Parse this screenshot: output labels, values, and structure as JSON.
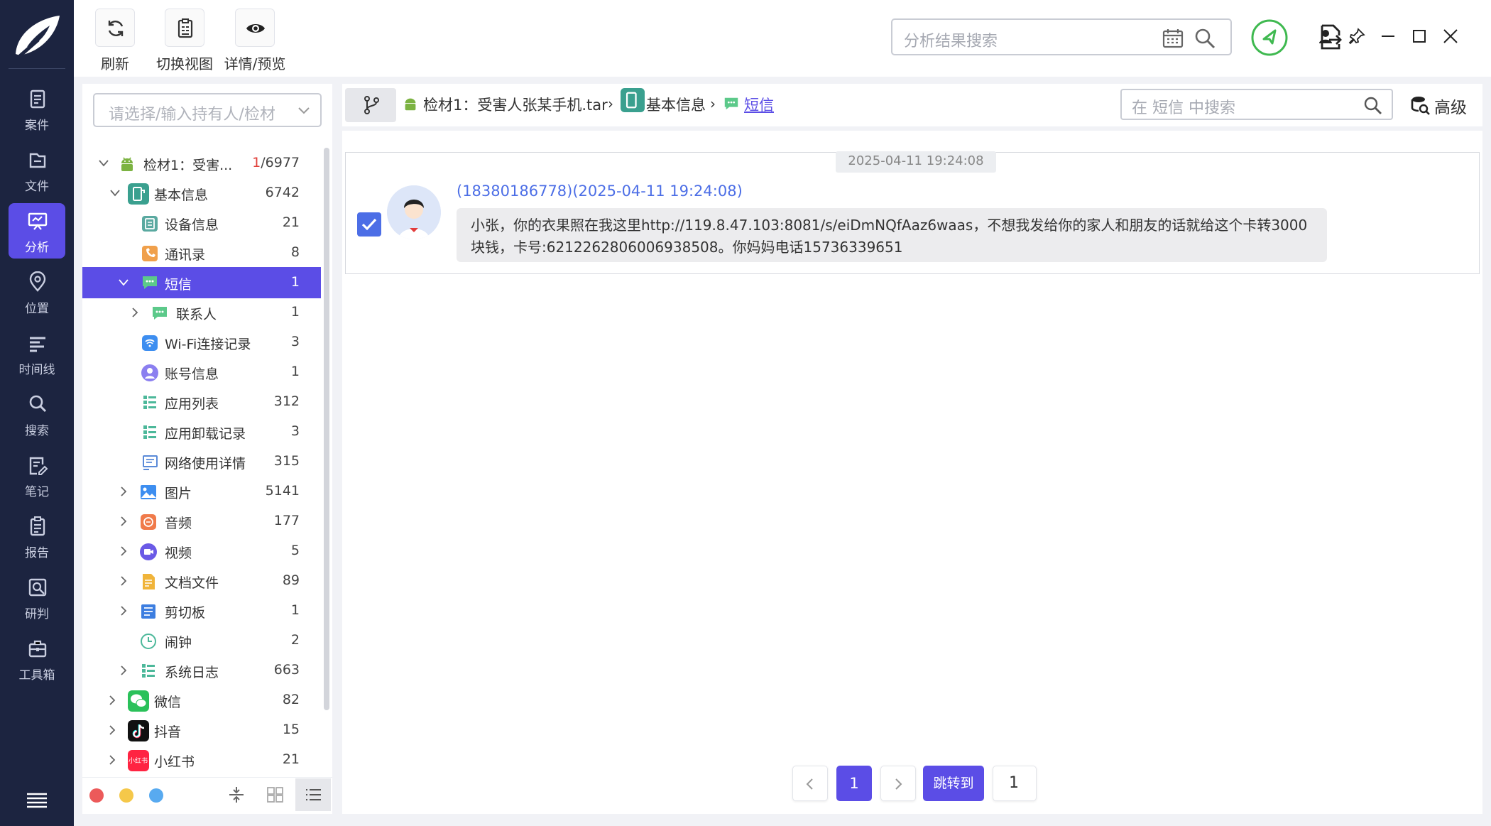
{
  "nav": {
    "items": [
      {
        "label": "案件",
        "icon": "clipboard-icon"
      },
      {
        "label": "文件",
        "icon": "folder-icon"
      },
      {
        "label": "分析",
        "icon": "analysis-icon"
      },
      {
        "label": "位置",
        "icon": "location-pin-icon"
      },
      {
        "label": "时间线",
        "icon": "timeline-icon"
      },
      {
        "label": "搜索",
        "icon": "search-icon"
      },
      {
        "label": "笔记",
        "icon": "note-icon"
      },
      {
        "label": "报告",
        "icon": "report-icon"
      },
      {
        "label": "研判",
        "icon": "judge-icon"
      },
      {
        "label": "工具箱",
        "icon": "toolbox-icon"
      }
    ],
    "active": "分析"
  },
  "toolbar": {
    "refresh_label": "刷新",
    "switch_view_label": "切换视图",
    "detail_preview_label": "详情/预览",
    "search_placeholder": "分析结果搜索"
  },
  "tree": {
    "select_placeholder": "请选择/输入持有人/检材",
    "rows": [
      {
        "name": "检材1：受害...",
        "count_hl": "1",
        "count_rest": "/6977",
        "icon": "android-icon"
      },
      {
        "name": "基本信息",
        "count": "6742",
        "icon": "basic-info-icon"
      },
      {
        "name": "设备信息",
        "count": "21",
        "icon": "device-info-icon"
      },
      {
        "name": "通讯录",
        "count": "8",
        "icon": "contacts-icon"
      },
      {
        "name": "短信",
        "count": "1",
        "icon": "sms-icon"
      },
      {
        "name": "联系人",
        "count": "1",
        "icon": "sms-contact-icon"
      },
      {
        "name": "Wi-Fi连接记录",
        "count": "3",
        "icon": "wifi-icon"
      },
      {
        "name": "账号信息",
        "count": "1",
        "icon": "account-icon"
      },
      {
        "name": "应用列表",
        "count": "312",
        "icon": "app-list-icon"
      },
      {
        "name": "应用卸载记录",
        "count": "3",
        "icon": "uninstall-icon"
      },
      {
        "name": "网络使用详情",
        "count": "315",
        "icon": "network-icon"
      },
      {
        "name": "图片",
        "count": "5141",
        "icon": "image-icon"
      },
      {
        "name": "音频",
        "count": "177",
        "icon": "audio-icon"
      },
      {
        "name": "视频",
        "count": "5",
        "icon": "video-icon"
      },
      {
        "name": "文档文件",
        "count": "89",
        "icon": "document-icon"
      },
      {
        "name": "剪切板",
        "count": "1",
        "icon": "clipboard-list-icon"
      },
      {
        "name": "闹钟",
        "count": "2",
        "icon": "clock-icon"
      },
      {
        "name": "系统日志",
        "count": "663",
        "icon": "syslog-icon"
      },
      {
        "name": "微信",
        "count": "82",
        "icon": "wechat-icon"
      },
      {
        "name": "抖音",
        "count": "15",
        "icon": "douyin-icon"
      },
      {
        "name": "小红书",
        "count": "21",
        "icon": "xiaohongshu-icon"
      }
    ],
    "xhs_badge": "小红书"
  },
  "breadcrumb": {
    "item1": "检材1：受害人张某手机.tar",
    "item2": "基本信息",
    "item3": "短信",
    "search_placeholder": "在 短信 中搜索",
    "advanced_label": "高级"
  },
  "message": {
    "date_chip": "2025-04-11 19:24:08",
    "sender": "(18380186778)(2025-04-11 19:24:08)",
    "body": "小张，你的衣果照在我这里http://119.8.47.103:8081/s/eiDmNQfAaz6waas，不想我发给你的家人和朋友的话就给这个卡转3000块钱，卡号:6212262806006938508。你妈妈电话15736339651"
  },
  "pager": {
    "current": "1",
    "jump_label": "跳转到",
    "jump_value": "1"
  },
  "colors": {
    "accent": "#5b4de6",
    "nav_bg": "#1c2440",
    "link_blue": "#4c6ee6",
    "dot_red": "#ec5a5a",
    "dot_yellow": "#f5c84a",
    "dot_blue": "#58aaf0"
  }
}
